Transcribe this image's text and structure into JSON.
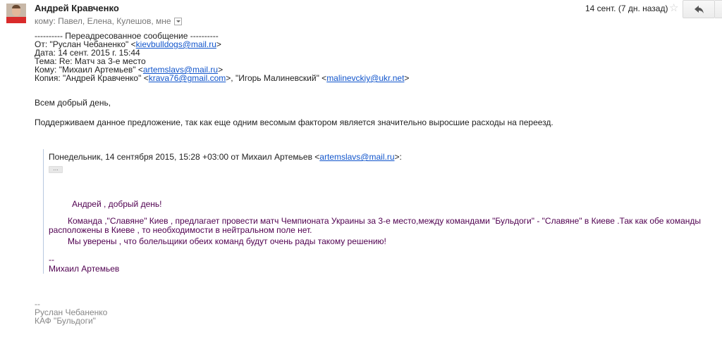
{
  "header": {
    "sender_name": "Андрей Кравченко",
    "recipients": "кому: Павел, Елена, Кулешов, мне",
    "date": "14 сент. (7 дн. назад)"
  },
  "forward": {
    "separator": "---------- Переадресованное сообщение ----------",
    "from_prefix": "От: \"Руслан Чебаненко\" <",
    "from_email": "kievbulldogs@mail.ru",
    "from_suffix": ">",
    "date_line": "Дата: 14 сент. 2015 г. 15:44",
    "subject_line": "Тема: Re: Матч за 3-е место",
    "to_prefix": "Кому: \"Михаил Артемьев\" <",
    "to_email": "artemslavs@mail.ru",
    "to_suffix": ">",
    "cc_prefix": "Копия: \"Андрей Кравченко\" <",
    "cc_email1": "krava76@gmail.com",
    "cc_middle": ">, \"Игорь Малиневский\" <",
    "cc_email2": "malinevckiy@ukr.net",
    "cc_suffix": ">"
  },
  "message": {
    "greeting": "Всем добрый день,",
    "paragraph": "Поддерживаем данное предложение, так как еще одним весомым фактором является значительно выросшие расходы на переезд."
  },
  "quote": {
    "header_prefix": "Понедельник, 14 сентября 2015, 15:28 +03:00 от Михаил Артемьев <",
    "header_email": "artemslavs@mail.ru",
    "header_suffix": ">:",
    "dots": "...",
    "greeting": "Андрей , добрый день!",
    "paragraph1": "Команда ,\"Славяне\" Киев , предлагает провести матч Чемпионата Украины за 3-е место,между командами \"Бульдоги\" - \"Славяне\" в Киеве .Так как обе команды расположены в Киеве , то необходимости в нейтральном поле нет.",
    "paragraph2": "Мы уверены , что болельщики обеих команд будут очень рады такому решению!",
    "sig_dash": "--",
    "sig_name": "Михаил Артемьев"
  },
  "signature": {
    "dash": "--",
    "name": "Руслан Чебаненко",
    "org": "КАФ \"Бульдоги\""
  }
}
